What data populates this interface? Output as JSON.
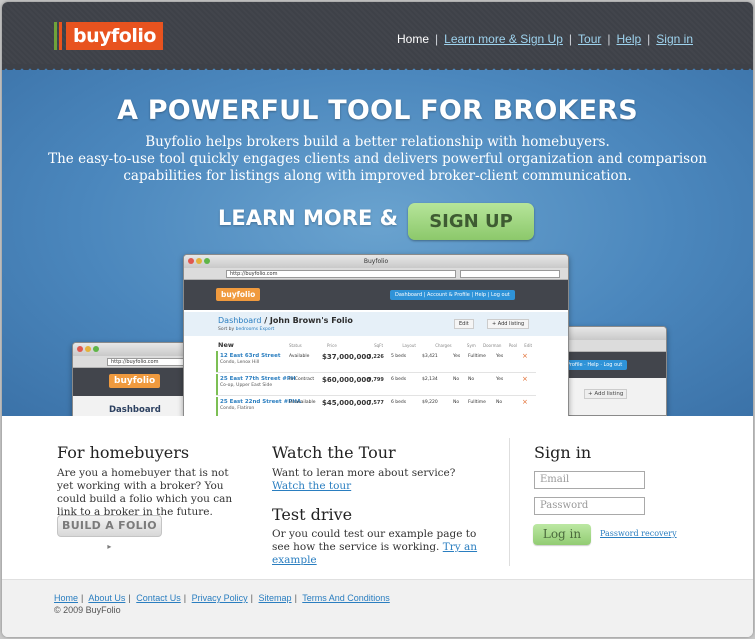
{
  "brand": {
    "logo_text": "buyfolio",
    "colors": {
      "header": "#3e4148",
      "logo_bg": "#e8531f",
      "link": "#2a7ec0",
      "accent_green": "#8cc86b",
      "hero_blue": "#4b87bd"
    }
  },
  "nav": {
    "items": [
      "Home",
      "Learn more & Sign Up",
      "Tour",
      "Help",
      "Sign in"
    ],
    "separator": "|"
  },
  "hero": {
    "title": "A POWERFUL TOOL FOR BROKERS",
    "description_line1": "Buyfolio helps brokers build a better relationship with homebuyers.",
    "description_line2": "The easy-to-use tool quickly engages clients and delivers powerful organization and comparison capabilities for listings along with improved broker-client communication.",
    "cta_prefix": "LEARN MORE &",
    "cta_button": "SIGN UP"
  },
  "preview": {
    "window_title": "Buyfolio",
    "url": "http://buyfolio.com",
    "back_url": "http://buyfolio.com",
    "logo": "buyfolio",
    "nav_items": [
      "Dashboard",
      "Account & Profile",
      "Help",
      "Log out"
    ],
    "nav_items_back": [
      "Profile",
      "Help",
      "Log out"
    ],
    "crumb_dashboard": "Dashboard",
    "crumb_sep": "/",
    "folio_title": "John Brown's Folio",
    "sort_prefix": "Sort by",
    "sort_value": "bedrooms",
    "export": "Export",
    "edit": "Edit",
    "add_listing": "+ Add listing",
    "section_new": "New",
    "back_dashboard": "Dashboard",
    "columns": [
      "Status",
      "Price",
      "SqFt",
      "Layout",
      "Charges",
      "Sym",
      "Doorman",
      "Pool",
      "Edit"
    ],
    "rows": [
      {
        "address": "12 East 63rd Street",
        "sub": "Condo, Lenox Hill",
        "status": "Available",
        "price": "$37,000,000",
        "sqft": "3,226",
        "beds": "5 beds",
        "charges": "$3,421",
        "a": "Yes",
        "b": "Fulltime",
        "c": "Yes"
      },
      {
        "address": "25 East 77th Street #PH",
        "sub": "Co-op, Upper East Side",
        "status": "In-Contract",
        "price": "$60,000,000",
        "sqft": "9,799",
        "beds": "6 beds",
        "charges": "$2,134",
        "a": "No",
        "b": "No",
        "c": "Yes"
      },
      {
        "address": "25 East 22nd Street #PHA",
        "sub": "Condo, Flatiron",
        "status": "Unavailable",
        "price": "$45,000,000",
        "sqft": "7,577",
        "beds": "6 beds",
        "charges": "$9,220",
        "a": "No",
        "b": "Fulltime",
        "c": "No"
      }
    ]
  },
  "homebuyers": {
    "title": "For homebuyers",
    "text": "Are you a homebuyer that is not yet working with a broker? You could build a folio which you can link to a broker in the future.",
    "button": "BUILD A FOLIO"
  },
  "tour": {
    "title": "Watch the Tour",
    "text": "Want to leran more about service?",
    "link": "Watch the tour"
  },
  "testdrive": {
    "title": "Test drive",
    "text": "Or you could test our example page to see how the service is working.",
    "link": "Try an example"
  },
  "signin": {
    "title": "Sign in",
    "email_placeholder": "Email",
    "password_placeholder": "Password",
    "button": "Log in",
    "recovery": "Password recovery"
  },
  "footer": {
    "links": [
      "Home",
      "About Us",
      "Contact Us",
      "Privacy Policy",
      "Sitemap",
      "Terms And Conditions"
    ],
    "copyright": "© 2009 BuyFolio"
  }
}
